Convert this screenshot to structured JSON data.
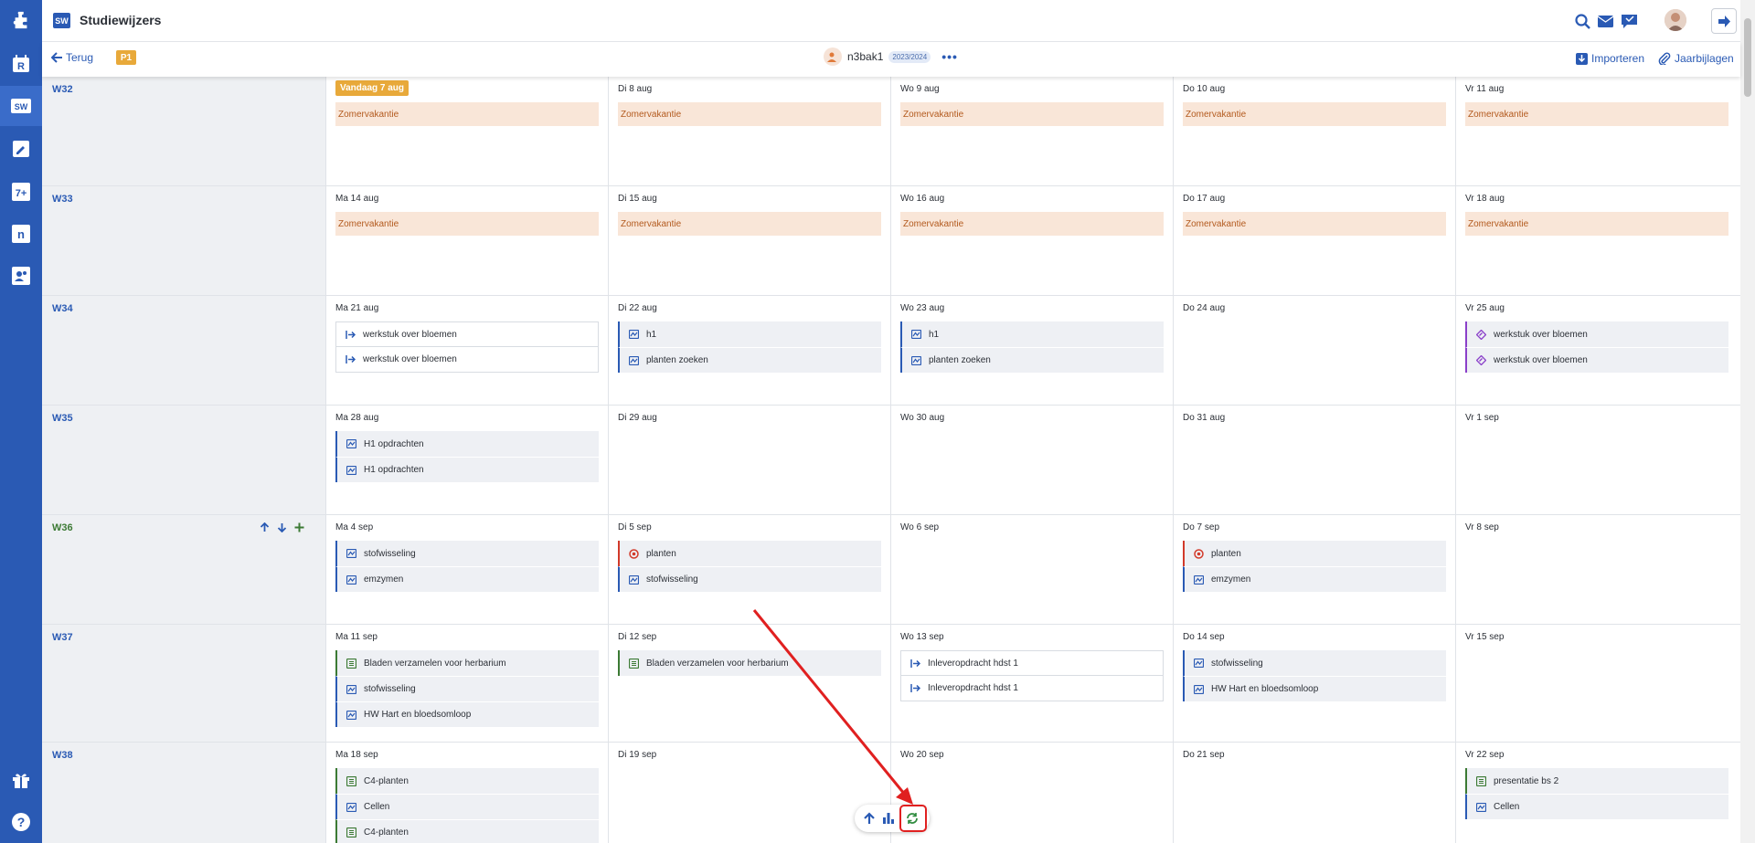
{
  "app": {
    "title": "Studiewijzers",
    "logo_text": "SW"
  },
  "sidebar": {
    "items": [
      {
        "icon": "puzzle-icon"
      },
      {
        "icon": "roster-icon",
        "text": "R"
      },
      {
        "icon": "studiewijzer-icon",
        "text": "SW",
        "active": true
      },
      {
        "icon": "edit-icon"
      },
      {
        "icon": "grades-icon",
        "text": "7+"
      },
      {
        "icon": "n-icon",
        "text": "n"
      },
      {
        "icon": "people-icon"
      },
      {
        "icon": "gift-icon"
      },
      {
        "icon": "help-icon",
        "text": "?"
      }
    ]
  },
  "topbar": {
    "icons": [
      "search-icon",
      "mail-icon",
      "messages-icon"
    ]
  },
  "subbar": {
    "back_label": "Terug",
    "period_badge": "P1",
    "user_name": "n3bak1",
    "school_year": "2023/2024",
    "more_label": "•••",
    "import_label": "Importeren",
    "attachments_label": "Jaarbijlagen"
  },
  "colors": {
    "primary": "#2a5ab4",
    "today": "#e8a93a",
    "vacation_bg": "#f9e6d8",
    "vacation_text": "#b35a1e",
    "current_week": "#3c7a34"
  },
  "weeks": [
    {
      "label": "W32",
      "days": [
        {
          "label": "Vandaag 7 aug",
          "today": true,
          "items": [
            {
              "type": "vak",
              "text": "Zomervakantie"
            }
          ]
        },
        {
          "label": "Di 8 aug",
          "items": [
            {
              "type": "vak",
              "text": "Zomervakantie"
            }
          ]
        },
        {
          "label": "Wo 9 aug",
          "items": [
            {
              "type": "vak",
              "text": "Zomervakantie"
            }
          ]
        },
        {
          "label": "Do 10 aug",
          "items": [
            {
              "type": "vak",
              "text": "Zomervakantie"
            }
          ]
        },
        {
          "label": "Vr 11 aug",
          "items": [
            {
              "type": "vak",
              "text": "Zomervakantie"
            }
          ]
        }
      ]
    },
    {
      "label": "W33",
      "days": [
        {
          "label": "Ma 14 aug",
          "items": [
            {
              "type": "vak",
              "text": "Zomervakantie"
            }
          ]
        },
        {
          "label": "Di 15 aug",
          "items": [
            {
              "type": "vak",
              "text": "Zomervakantie"
            }
          ]
        },
        {
          "label": "Wo 16 aug",
          "items": [
            {
              "type": "vak",
              "text": "Zomervakantie"
            }
          ]
        },
        {
          "label": "Do 17 aug",
          "items": [
            {
              "type": "vak",
              "text": "Zomervakantie"
            }
          ]
        },
        {
          "label": "Vr 18 aug",
          "items": [
            {
              "type": "vak",
              "text": "Zomervakantie"
            }
          ]
        }
      ]
    },
    {
      "label": "W34",
      "days": [
        {
          "label": "Ma 21 aug",
          "items": [
            {
              "type": "lv",
              "text": "werkstuk over bloemen"
            },
            {
              "type": "lv",
              "text": "werkstuk over bloemen"
            }
          ]
        },
        {
          "label": "Di 22 aug",
          "items": [
            {
              "type": "hw",
              "text": "h1"
            },
            {
              "type": "hw",
              "text": "planten zoeken"
            }
          ]
        },
        {
          "label": "Wo 23 aug",
          "items": [
            {
              "type": "hw",
              "text": "h1"
            },
            {
              "type": "hw",
              "text": "planten zoeken"
            }
          ]
        },
        {
          "label": "Do 24 aug",
          "items": []
        },
        {
          "label": "Vr 25 aug",
          "items": [
            {
              "type": "pw",
              "text": "werkstuk over bloemen"
            },
            {
              "type": "pw",
              "text": "werkstuk over bloemen"
            }
          ]
        }
      ]
    },
    {
      "label": "W35",
      "days": [
        {
          "label": "Ma 28 aug",
          "items": [
            {
              "type": "hw",
              "text": "H1 opdrachten"
            },
            {
              "type": "hw",
              "text": "H1 opdrachten"
            }
          ]
        },
        {
          "label": "Di 29 aug",
          "items": []
        },
        {
          "label": "Wo 30 aug",
          "items": []
        },
        {
          "label": "Do 31 aug",
          "items": []
        },
        {
          "label": "Vr 1 sep",
          "items": []
        }
      ]
    },
    {
      "label": "W36",
      "current": true,
      "days": [
        {
          "label": "Ma 4 sep",
          "items": [
            {
              "type": "hw",
              "text": "stofwisseling"
            },
            {
              "type": "hw",
              "text": "emzymen"
            }
          ]
        },
        {
          "label": "Di 5 sep",
          "items": [
            {
              "type": "ts",
              "text": "planten"
            },
            {
              "type": "hw",
              "text": "stofwisseling"
            }
          ]
        },
        {
          "label": "Wo 6 sep",
          "items": []
        },
        {
          "label": "Do 7 sep",
          "items": [
            {
              "type": "ts",
              "text": "planten"
            },
            {
              "type": "hw",
              "text": "emzymen"
            }
          ]
        },
        {
          "label": "Vr 8 sep",
          "items": []
        }
      ]
    },
    {
      "label": "W37",
      "days": [
        {
          "label": "Ma 11 sep",
          "items": [
            {
              "type": "sm",
              "text": "Bladen verzamelen voor herbarium"
            },
            {
              "type": "hw",
              "text": "stofwisseling"
            },
            {
              "type": "hw",
              "text": "HW Hart en bloedsomloop"
            }
          ]
        },
        {
          "label": "Di 12 sep",
          "items": [
            {
              "type": "sm",
              "text": "Bladen verzamelen voor herbarium"
            }
          ]
        },
        {
          "label": "Wo 13 sep",
          "items": [
            {
              "type": "lv",
              "text": "Inleveropdracht hdst 1"
            },
            {
              "type": "lv",
              "text": "Inleveropdracht hdst 1"
            }
          ]
        },
        {
          "label": "Do 14 sep",
          "items": [
            {
              "type": "hw",
              "text": "stofwisseling"
            },
            {
              "type": "hw",
              "text": "HW Hart en bloedsomloop"
            }
          ]
        },
        {
          "label": "Vr 15 sep",
          "items": []
        }
      ]
    },
    {
      "label": "W38",
      "days": [
        {
          "label": "Ma 18 sep",
          "items": [
            {
              "type": "sm",
              "text": "C4-planten"
            },
            {
              "type": "hw",
              "text": "Cellen"
            },
            {
              "type": "sm",
              "text": "C4-planten"
            }
          ]
        },
        {
          "label": "Di 19 sep",
          "items": []
        },
        {
          "label": "Wo 20 sep",
          "items": []
        },
        {
          "label": "Do 21 sep",
          "items": []
        },
        {
          "label": "Vr 22 sep",
          "items": [
            {
              "type": "sm",
              "text": "presentatie bs 2"
            },
            {
              "type": "hw",
              "text": "Cellen"
            }
          ]
        }
      ]
    }
  ],
  "floating_toolbar": {
    "buttons": [
      "scroll-up-icon",
      "statistics-icon",
      "sync-icon"
    ]
  }
}
